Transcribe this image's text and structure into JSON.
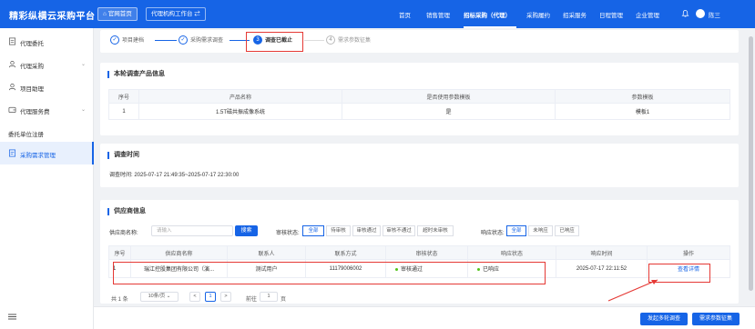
{
  "header": {
    "brand": "精彩纵横云采购平台",
    "portal_btn": "官网首页",
    "workspace_btn": "代理机构工作台 ⇄",
    "nav": [
      "首页",
      "销售管理",
      "招标采购（代理）",
      "采购履约",
      "招采服务",
      "日程管理",
      "企业管理"
    ],
    "active_nav": "招标采购（代理）",
    "username": "陈三"
  },
  "sidebar": {
    "items": [
      {
        "label": "代理委托",
        "icon": "document-icon"
      },
      {
        "label": "代理采购",
        "icon": "user-icon",
        "expand": "⌄"
      },
      {
        "label": "项目助理",
        "icon": "user-icon"
      },
      {
        "label": "代理服务费",
        "icon": "wallet-icon",
        "expand": "⌄"
      },
      {
        "label": "委托单位注册"
      },
      {
        "label": "采购需求管理",
        "icon": "list-icon"
      }
    ],
    "active": "采购需求管理"
  },
  "steps": [
    {
      "label": "项目建档",
      "status": "done",
      "mark": "✓"
    },
    {
      "label": "采购需求调查",
      "status": "done",
      "mark": "✓"
    },
    {
      "label": "调查已截止",
      "status": "current",
      "mark": "3"
    },
    {
      "label": "需求参数征集",
      "status": "todo",
      "mark": "4"
    }
  ],
  "product_section": {
    "title": "本轮调查产品信息",
    "columns": [
      "序号",
      "产品名称",
      "是否使用参数模板",
      "参数模板"
    ],
    "rows": [
      [
        "1",
        "1.5T磁共振成像系统",
        "是",
        "模板1"
      ]
    ]
  },
  "time_section": {
    "title": "调查时间",
    "label": "调查时间:",
    "value": "2025-07-17 21:49:35~2025-07-17 22:30:00"
  },
  "supplier_section": {
    "title": "供应商信息",
    "name_label": "供应商名称:",
    "name_placeholder": "请输入",
    "search_btn": "搜索",
    "review_label": "审核状态:",
    "review_options": [
      "全部",
      "待审核",
      "审核通过",
      "审核不通过",
      "超时未审核"
    ],
    "response_label": "响应状态:",
    "response_options": [
      "全部",
      "未响应",
      "已响应"
    ],
    "columns": [
      "序号",
      "供应商名称",
      "联系人",
      "联系方式",
      "审核状态",
      "响应状态",
      "响应时间",
      "操作"
    ],
    "rows": [
      {
        "no": "1",
        "name": "瑞江控股集团有限公司（演...",
        "contact": "测试用户",
        "phone": "11179006002",
        "review": "审核通过",
        "response": "已响应",
        "time": "2025-07-17 22:11:52",
        "action": "查看详情"
      }
    ],
    "pager": {
      "total": "共 1 条",
      "page_size": "10条/页",
      "prev": "<",
      "current": "1",
      "next": ">",
      "goto_label": "前往",
      "goto_value": "1",
      "page_unit": "页"
    }
  },
  "footer": {
    "btn1": "发起多轮调查",
    "btn2": "需求参数征集"
  },
  "colors": {
    "primary": "#1664e6",
    "highlight": "#e53935",
    "success": "#52c41a"
  }
}
